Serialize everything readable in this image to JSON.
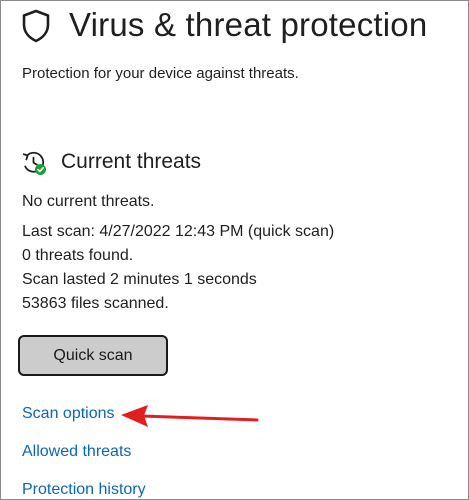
{
  "header": {
    "icon": "shield-icon",
    "title": "Virus & threat protection",
    "subtitle": "Protection for your device against threats."
  },
  "current_threats": {
    "icon": "clock-refresh-check-icon",
    "title": "Current threats",
    "lines": [
      "No current threats.",
      "Last scan: 4/27/2022 12:43 PM (quick scan)",
      "0 threats found.",
      "Scan lasted 2 minutes 1 seconds",
      "53863 files scanned."
    ],
    "quick_scan_label": "Quick scan"
  },
  "links": {
    "scan_options": "Scan options",
    "allowed_threats": "Allowed threats",
    "protection_history": "Protection history"
  },
  "annotation": {
    "icon": "red-arrow-icon",
    "color": "#e02020"
  },
  "colors": {
    "link": "#0a67b5",
    "button_bg": "#cccccc",
    "status_check": "#1e9e3a"
  }
}
